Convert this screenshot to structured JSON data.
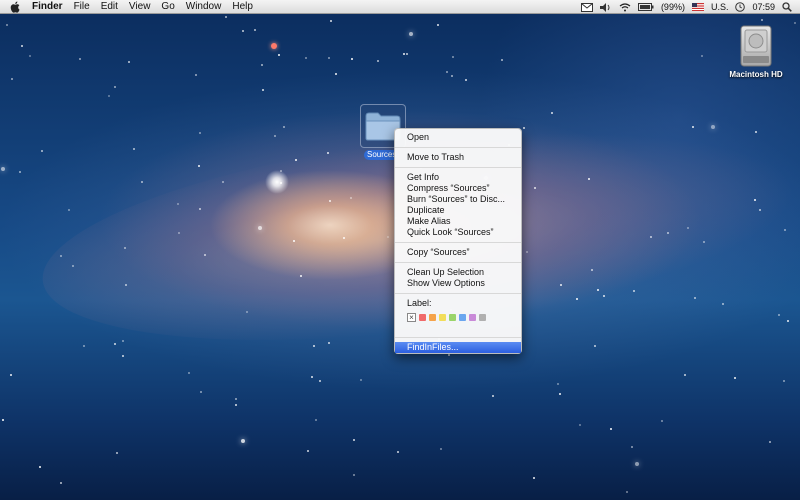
{
  "menubar": {
    "app_name": "Finder",
    "menus": [
      "File",
      "Edit",
      "View",
      "Go",
      "Window",
      "Help"
    ],
    "battery": "(99%)",
    "input_source": "U.S.",
    "clock": "07:59"
  },
  "desktop": {
    "hd_label": "Macintosh HD",
    "folder_label": "Sources"
  },
  "context_menu": {
    "open": "Open",
    "move_to_trash": "Move to Trash",
    "get_info": "Get Info",
    "compress": "Compress “Sources”",
    "burn": "Burn “Sources” to Disc...",
    "duplicate": "Duplicate",
    "make_alias": "Make Alias",
    "quick_look": "Quick Look “Sources”",
    "copy": "Copy “Sources”",
    "clean_up": "Clean Up Selection",
    "show_view_options": "Show View Options",
    "label_title": "Label:",
    "label_colors": [
      "#f06a6a",
      "#f5a34a",
      "#f2dd5a",
      "#9ad46a",
      "#6aa6ef",
      "#c98ad8",
      "#b0b0b0"
    ],
    "service": "FindInFiles..."
  },
  "colors": {
    "highlight": "#3a6fe8",
    "selection_label": "#2f6bd6"
  }
}
